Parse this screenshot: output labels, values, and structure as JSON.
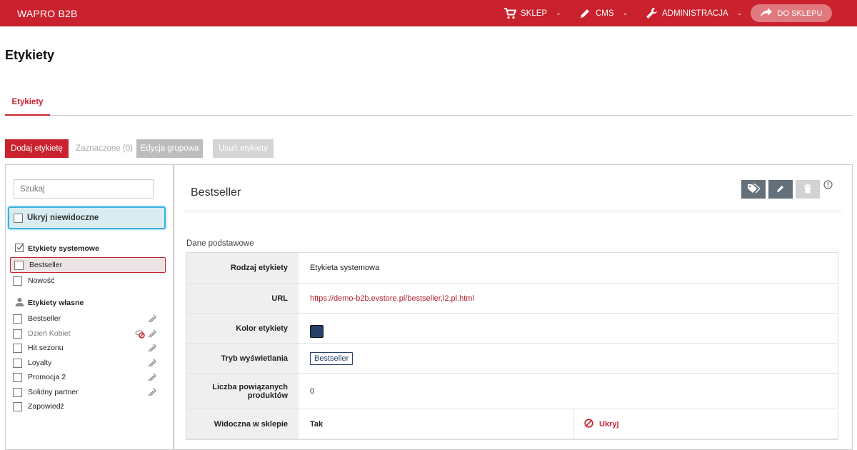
{
  "topbar": {
    "brand": "WAPRO B2B",
    "nav": [
      {
        "label": "SKLEP",
        "icon": "cart-icon"
      },
      {
        "label": "CMS",
        "icon": "pencil-icon"
      },
      {
        "label": "ADMINISTRACJA",
        "icon": "wrench-icon"
      }
    ],
    "goshop_label": "DO SKLEPU"
  },
  "page": {
    "title": "Etykiety",
    "tab": "Etykiety"
  },
  "toolbar": {
    "add": "Dodaj etykietę",
    "selected": "Zaznaczone (0)",
    "group_edit": "Edycja grupowa",
    "delete": "Usuń etykiety"
  },
  "sidebar": {
    "search_placeholder": "Szukaj",
    "hide_invisible": "Ukryj niewidoczne",
    "system_heading": "Etykiety systemowe",
    "system_items": [
      {
        "label": "Bestseller"
      },
      {
        "label": "Nowość"
      }
    ],
    "own_heading": "Etykiety własne",
    "own_items": [
      {
        "label": "Bestseller"
      },
      {
        "label": "Dzień Kobiet"
      },
      {
        "label": "Hit sezonu"
      },
      {
        "label": "Loyalty"
      },
      {
        "label": "Promocja 2"
      },
      {
        "label": "Solidny partner"
      },
      {
        "label": "Zapowiedź"
      }
    ]
  },
  "detail": {
    "title": "Bestseller",
    "section": "Dane podstawowe",
    "rows": {
      "type_label": "Rodzaj etykiety",
      "type_value": "Etykieta systemowa",
      "url_label": "URL",
      "url_value": "https://demo-b2b.evstore.pl/bestseller,l2,pl.html",
      "color_label": "Kolor etykiety",
      "color_value": "#26406a",
      "mode_label": "Tryb wyświetlania",
      "mode_value": "Bestseller",
      "count_label": "Liczba powiązanych produktów",
      "count_value": "0",
      "visible_label": "Widoczna w sklepie",
      "visible_value": "Tak",
      "hide_action": "Ukryj"
    }
  },
  "colors": {
    "accent": "#c9212d",
    "highlight": "#3ab0dd",
    "label_color": "#26406a"
  }
}
